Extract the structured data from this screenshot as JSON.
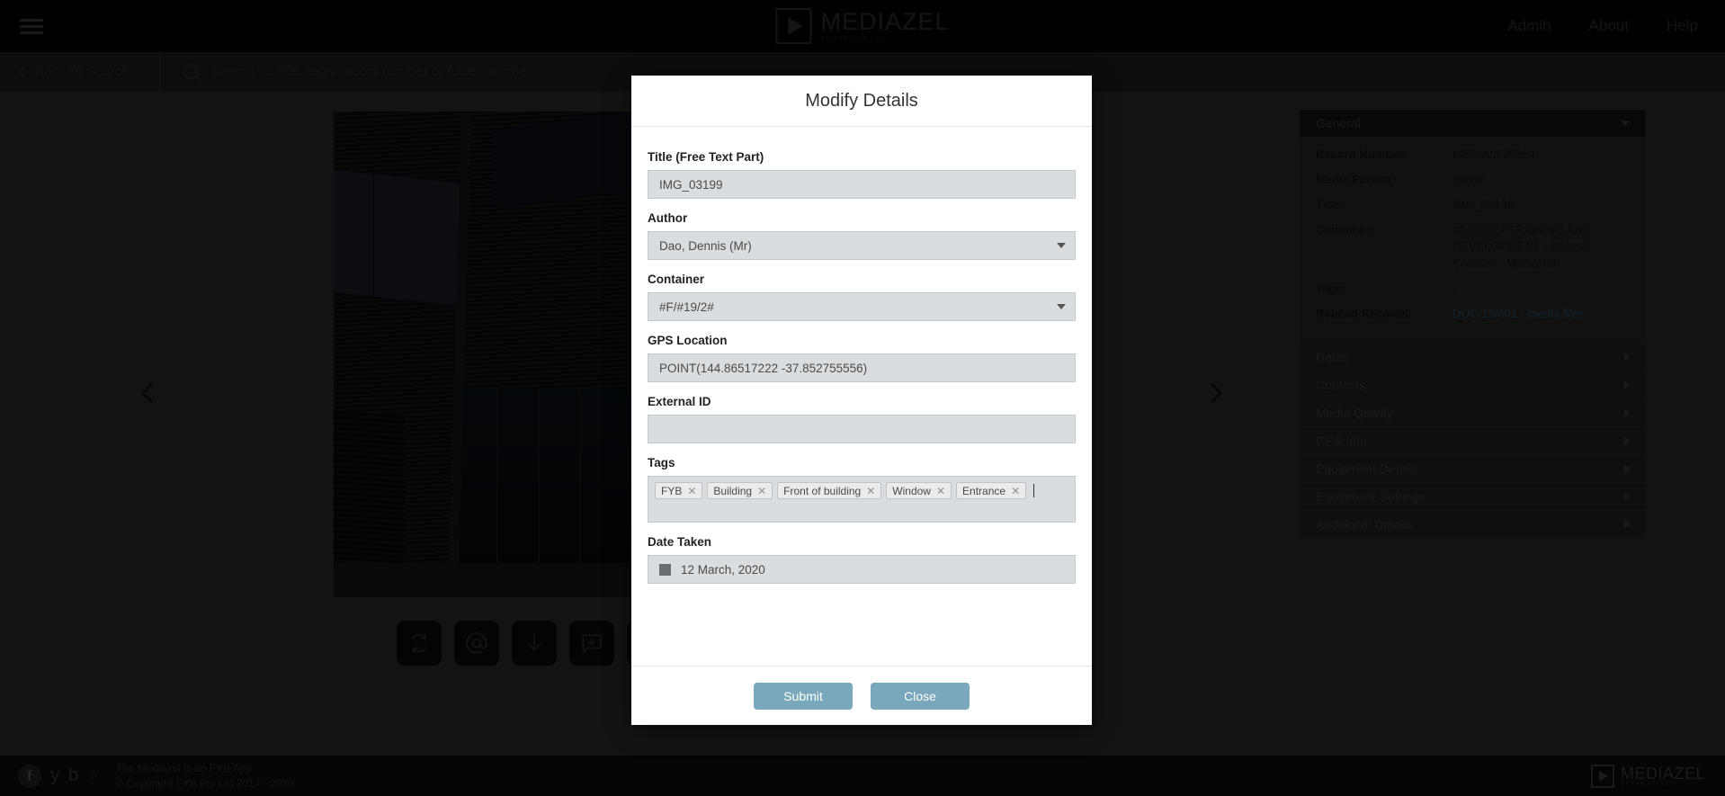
{
  "header": {
    "menu_icon": "hamburger-icon",
    "brand_name": "MEDIAZEL",
    "brand_sub": "BY FYB PTY LTD",
    "nav": [
      {
        "label": "Admin"
      },
      {
        "label": "About"
      },
      {
        "label": "Help"
      }
    ]
  },
  "searchbar": {
    "back_label": "Back To Search",
    "search_placeholder": "Search via title, tags, record number or folder number",
    "search_value": ""
  },
  "viewer": {
    "prev_label": "Previous",
    "next_label": "Next",
    "actions": [
      {
        "name": "rotate-icon"
      },
      {
        "name": "mention-icon"
      },
      {
        "name": "download-icon"
      },
      {
        "name": "download-comment-icon"
      },
      {
        "name": "share-icon"
      }
    ]
  },
  "metadata": {
    "sections": [
      {
        "label": "General",
        "open": true
      },
      {
        "label": "Dates",
        "open": false
      },
      {
        "label": "Contacts",
        "open": false
      },
      {
        "label": "Media Quality",
        "open": false
      },
      {
        "label": "GPS Info",
        "open": false
      },
      {
        "label": "Equipment Details",
        "open": false
      },
      {
        "label": "Equipment Settings",
        "open": false
      },
      {
        "label": "Additional Details",
        "open": false
      }
    ],
    "general_rows": [
      {
        "key": "Record Number:",
        "value": "MEDIA/20/5364",
        "link": false
      },
      {
        "key": "Media Format:",
        "value": "Image",
        "link": false
      },
      {
        "key": "Title:",
        "value": "IMG_03199",
        "link": false
      },
      {
        "key": "Container:",
        "value": "#F/#19/2# TRAINING AND DEVELOPMENT - Internal Courses - MediaHub",
        "link": false
      },
      {
        "key": "Tags:",
        "value": "-",
        "link": false
      },
      {
        "key": "Related Records:",
        "value": "DOC/19/801 - media files",
        "link": true
      }
    ]
  },
  "modal": {
    "title": "Modify Details",
    "fields": {
      "title_label": "Title (Free Text Part)",
      "title_value": "IMG_03199",
      "author_label": "Author",
      "author_value": "Dao, Dennis (Mr)",
      "container_label": "Container",
      "container_value": "#F/#19/2#",
      "gps_label": "GPS Location",
      "gps_value": "POINT(144.86517222 -37.852755556)",
      "external_id_label": "External ID",
      "external_id_value": "",
      "tags_label": "Tags",
      "date_label": "Date Taken",
      "date_value": "12 March, 2020"
    },
    "tags": [
      {
        "label": "FYB"
      },
      {
        "label": "Building"
      },
      {
        "label": "Front of building"
      },
      {
        "label": "Window"
      },
      {
        "label": "Entrance"
      }
    ],
    "submit_label": "Submit",
    "close_label": "Close"
  },
  "footer": {
    "social": [
      {
        "name": "facebook-icon",
        "glyph": "f"
      },
      {
        "name": "twitter-icon",
        "glyph": "y"
      },
      {
        "name": "blogger-icon",
        "glyph": "b"
      },
      {
        "name": "more-icon",
        "glyph": "⁘"
      }
    ],
    "line1": "The Mediazel is an FYB App",
    "line2": "© Copyright FYB Pty Ltd 2017 - 2020",
    "brand_name": "MEDIAZEL",
    "brand_sub": "BY FYB PTY LTD"
  },
  "colors": {
    "accent": "#79a7bb",
    "field_bg": "#dadde0",
    "modal_bg": "#ffffff",
    "link": "#2c4a5c"
  }
}
